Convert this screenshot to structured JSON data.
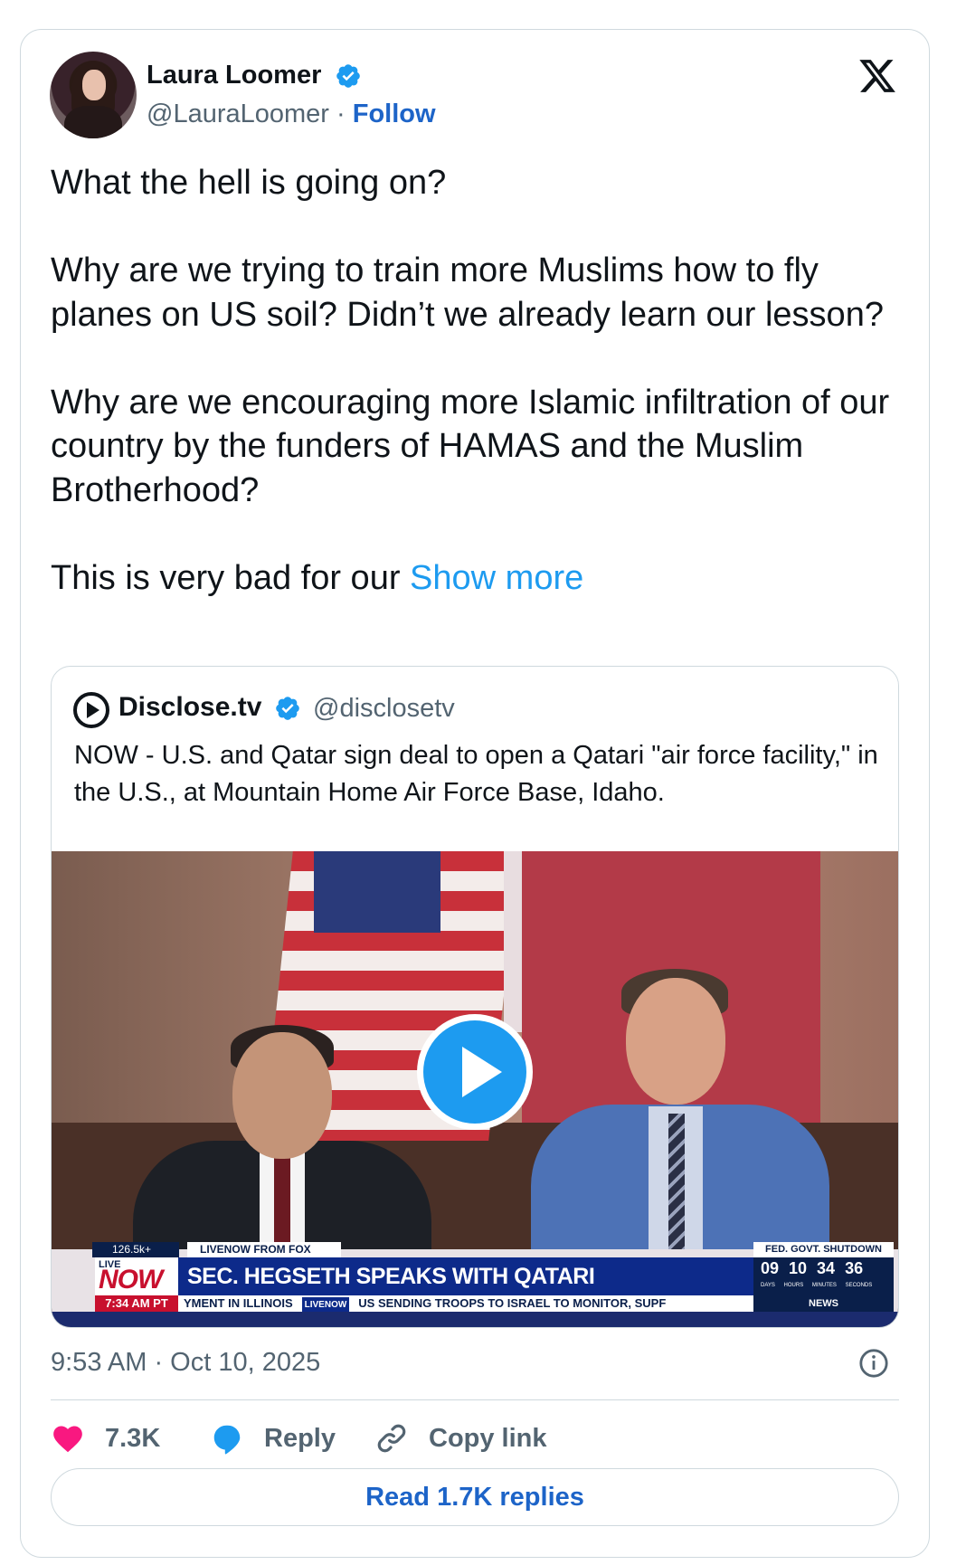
{
  "author": {
    "name": "Laura Loomer",
    "handle": "@LauraLoomer",
    "separator": "·",
    "follow_label": "Follow"
  },
  "tweet": {
    "paragraphs": [
      "What the hell is going on?",
      "Why are we trying to train more Muslims how to fly planes on US soil? Didn’t we already learn our lesson?",
      "Why are we encouraging more Islamic infiltration of our country by the funders of HAMAS and the Muslim Brotherhood?"
    ],
    "last_line": "This is very bad for our",
    "show_more": "Show more"
  },
  "quote": {
    "name": "Disclose.tv",
    "handle": "@disclosetv",
    "text": "NOW - U.S. and Qatar sign deal to open a Qatari \"air force facility,\" in the U.S., at Mountain Home Air Force Base, Idaho.",
    "video": {
      "views": "126.5k+",
      "livenow_label": "LIVENOW FROM FOX",
      "shutdown_label": "FED. GOVT. SHUTDOWN",
      "live_label": "LIVE",
      "now_label": "NOW",
      "headline": "SEC. HEGSETH SPEAKS WITH QATARI COUNTERPART",
      "clock": "09 10 34 36",
      "clock_labels": "DAYS HOURS MINUTES SECONDS",
      "time": "7:34 AM PT",
      "ticker_left": "YMENT IN ILLINOIS",
      "ticker_badge": "LIVENOW",
      "ticker_right": "US SENDING TROOPS TO ISRAEL TO MONITOR, SUPF",
      "news_label": "NEWS"
    }
  },
  "timestamp": "9:53 AM · Oct 10, 2025",
  "actions": {
    "likes": "7.3K",
    "reply_label": "Reply",
    "copy_label": "Copy link"
  },
  "read_replies": "Read 1.7K replies",
  "colors": {
    "link": "#1d64c8",
    "show_more": "#1d9bf0",
    "like": "#f91880",
    "verified": "#1d9bf0"
  },
  "icons": [
    "verified-badge-icon",
    "x-logo-icon",
    "disclose-logo-icon",
    "play-icon",
    "info-icon",
    "heart-icon",
    "reply-bubble-icon",
    "link-icon"
  ]
}
